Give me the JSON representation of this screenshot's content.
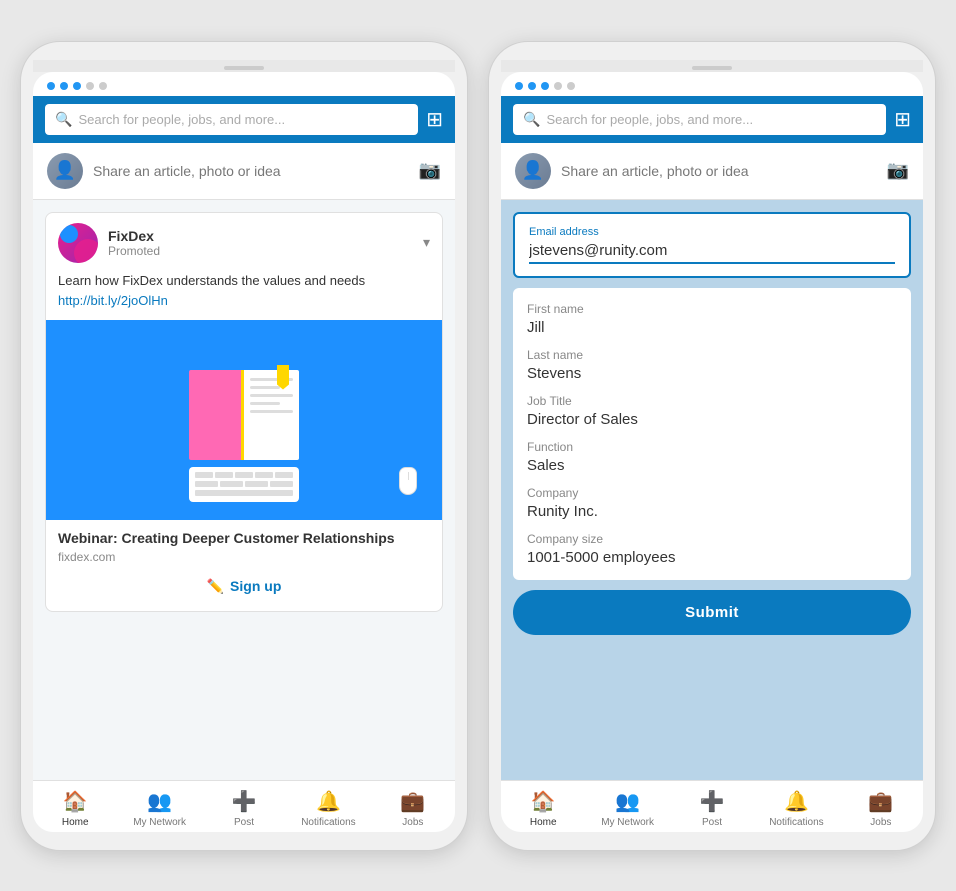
{
  "left_phone": {
    "dots": [
      "fill",
      "fill",
      "fill",
      "empty",
      "empty"
    ],
    "search_placeholder": "Search for people, jobs, and more...",
    "share_text": "Share an article, photo or idea",
    "ad": {
      "company_name": "FixDex",
      "promoted": "Promoted",
      "tagline": "Learn how FixDex understands the values and needs",
      "link": "http://bit.ly/2joOlHn",
      "webinar_title": "Webinar: Creating Deeper Customer Relationships",
      "domain": "fixdex.com",
      "signup_label": "Sign up"
    },
    "nav": {
      "items": [
        {
          "id": "home",
          "label": "Home",
          "active": true
        },
        {
          "id": "network",
          "label": "My Network",
          "active": false
        },
        {
          "id": "post",
          "label": "Post",
          "active": false
        },
        {
          "id": "notifications",
          "label": "Notifications",
          "active": false
        },
        {
          "id": "jobs",
          "label": "Jobs",
          "active": false
        }
      ]
    }
  },
  "right_phone": {
    "dots": [
      "fill",
      "fill",
      "fill",
      "empty",
      "empty"
    ],
    "search_placeholder": "Search for people, jobs, and more...",
    "share_text": "Share an article, photo or idea",
    "form": {
      "email_label": "Email address",
      "email_value": "jstevens@runity.com",
      "first_name_label": "First name",
      "first_name_value": "Jill",
      "last_name_label": "Last name",
      "last_name_value": "Stevens",
      "job_title_label": "Job Title",
      "job_title_value": "Director of Sales",
      "function_label": "Function",
      "function_value": "Sales",
      "company_label": "Company",
      "company_value": "Runity Inc.",
      "company_size_label": "Company size",
      "company_size_value": "1001-5000 employees",
      "submit_label": "Submit"
    },
    "nav": {
      "items": [
        {
          "id": "home",
          "label": "Home",
          "active": true
        },
        {
          "id": "network",
          "label": "My Network",
          "active": false
        },
        {
          "id": "post",
          "label": "Post",
          "active": false
        },
        {
          "id": "notifications",
          "label": "Notifications",
          "active": false
        },
        {
          "id": "jobs",
          "label": "Jobs",
          "active": false
        }
      ]
    }
  }
}
